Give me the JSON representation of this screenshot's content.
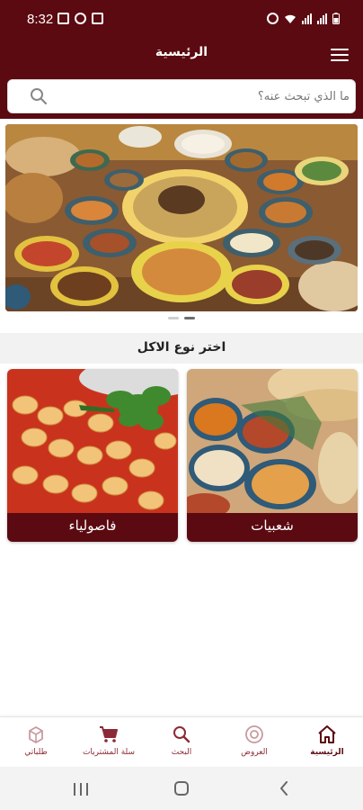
{
  "status_bar": {
    "time": "8:32"
  },
  "app_bar": {
    "title": "الرئيسية"
  },
  "search": {
    "placeholder": "ما الذي تبحث عنه؟",
    "value": ""
  },
  "banner": {
    "slides": 2,
    "active_slide": 2
  },
  "section": {
    "title": "اختر نوع الاكل"
  },
  "categories": [
    {
      "label": "شعبيات"
    },
    {
      "label": "فاصولياء"
    }
  ],
  "bottom_nav": {
    "items": [
      {
        "label": "الرئيسية",
        "icon": "home-icon",
        "active": true
      },
      {
        "label": "العروض",
        "icon": "offers-icon",
        "active": false
      },
      {
        "label": "البحث",
        "icon": "search-icon",
        "active": false
      },
      {
        "label": "سلة المشتريات",
        "icon": "cart-icon",
        "active": false
      },
      {
        "label": "طلباتي",
        "icon": "orders-icon",
        "active": false
      }
    ]
  },
  "colors": {
    "primary": "#5b0a11",
    "nav_label": "#8b2a35",
    "section_bg": "#f2f2f2"
  }
}
